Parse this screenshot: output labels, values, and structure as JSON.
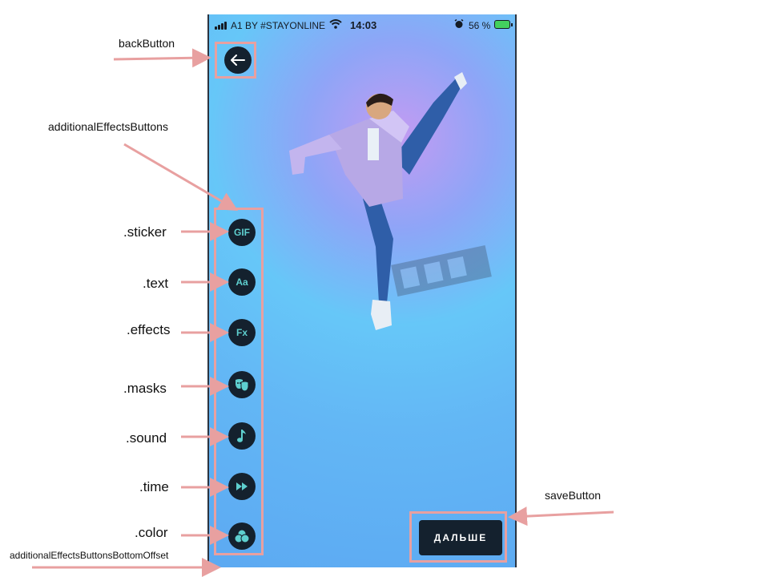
{
  "status_bar": {
    "carrier": "A1 BY #STAYONLINE",
    "time": "14:03",
    "battery": "56 %"
  },
  "buttons": {
    "back_icon": "arrow-left-icon",
    "save_label": "ДАЛЬШЕ",
    "effects": [
      {
        "key": "sticker",
        "glyph": "GIF"
      },
      {
        "key": "text",
        "glyph": "Aa"
      },
      {
        "key": "effects",
        "glyph": "Fx"
      },
      {
        "key": "masks",
        "icon": "mask-icon"
      },
      {
        "key": "sound",
        "icon": "music-note-icon"
      },
      {
        "key": "time",
        "icon": "fast-forward-icon"
      },
      {
        "key": "color",
        "icon": "color-circles-icon"
      }
    ]
  },
  "annotations": {
    "back_button": "backButton",
    "additional_effects_buttons": "additionalEffectsButtons",
    "sticker": ".sticker",
    "text": ".text",
    "effects": ".effects",
    "masks": ".masks",
    "sound": ".sound",
    "time": ".time",
    "color": ".color",
    "bottom_offset": "additionalEffectsButtonsBottomOffset",
    "save_button": "saveButton"
  },
  "colors": {
    "annotation_pink": "#e8a0a0",
    "button_dark": "#14212e",
    "icon_teal": "#5ecfcf",
    "background_blue": "#5ca9f2"
  }
}
